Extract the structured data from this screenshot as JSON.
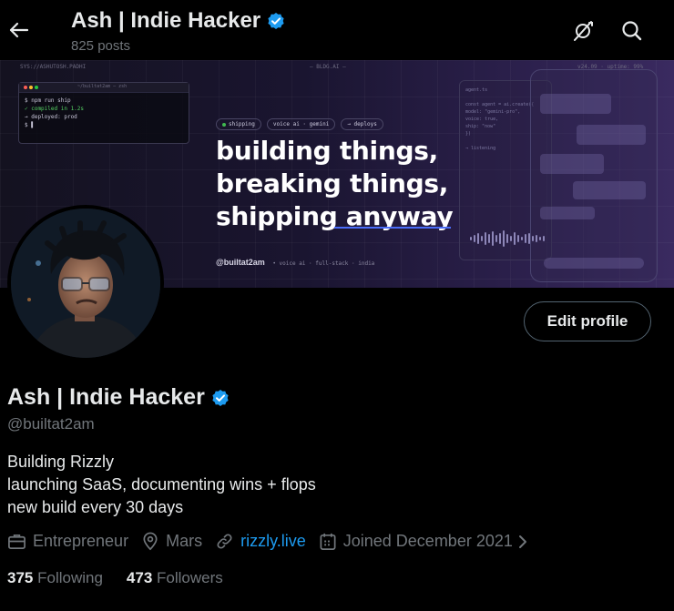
{
  "header": {
    "title": "Ash | Indie Hacker",
    "posts": "825 posts"
  },
  "banner": {
    "meta_left": "SYS://ASHUTOSH.PADHI",
    "meta_center": "— BLDG.AI —",
    "meta_right": "v24.09 · uptime: 99%",
    "terminal_title": "~/builtat2am — zsh",
    "terminal_lines": [
      "$ npm run ship",
      "✓ compiled in 1.2s",
      "→ deployed: prod",
      "$ ▌"
    ],
    "chips": [
      "shipping",
      "voice ai · gemini",
      "→ deploys"
    ],
    "headline": [
      "building things,",
      "breaking things,",
      "shipping anyway"
    ],
    "handle": "@builtat2am",
    "handle_tags": "• voice ai · full-stack · india",
    "code_lines": [
      "agent.ts",
      "",
      "const agent = ai.create({",
      "  model: \"gemini-pro\",",
      "  voice: true,",
      "  ship: \"now\"",
      "})",
      "",
      "→ listening"
    ]
  },
  "profile": {
    "name": "Ash | Indie Hacker",
    "handle": "@builtat2am",
    "edit_label": "Edit profile",
    "bio": [
      "Building Rizzly",
      "launching SaaS, documenting wins + flops",
      "new build every 30 days"
    ],
    "category": "Entrepreneur",
    "location": "Mars",
    "website": "rizzly.live",
    "joined": "Joined December 2021",
    "following_count": "375",
    "following_label": "Following",
    "followers_count": "473",
    "followers_label": "Followers"
  },
  "colors": {
    "background": "#000000",
    "text": "#e7e9ea",
    "muted": "#71767b",
    "accent": "#1d9bf0",
    "verified": "#1d9bf0"
  }
}
